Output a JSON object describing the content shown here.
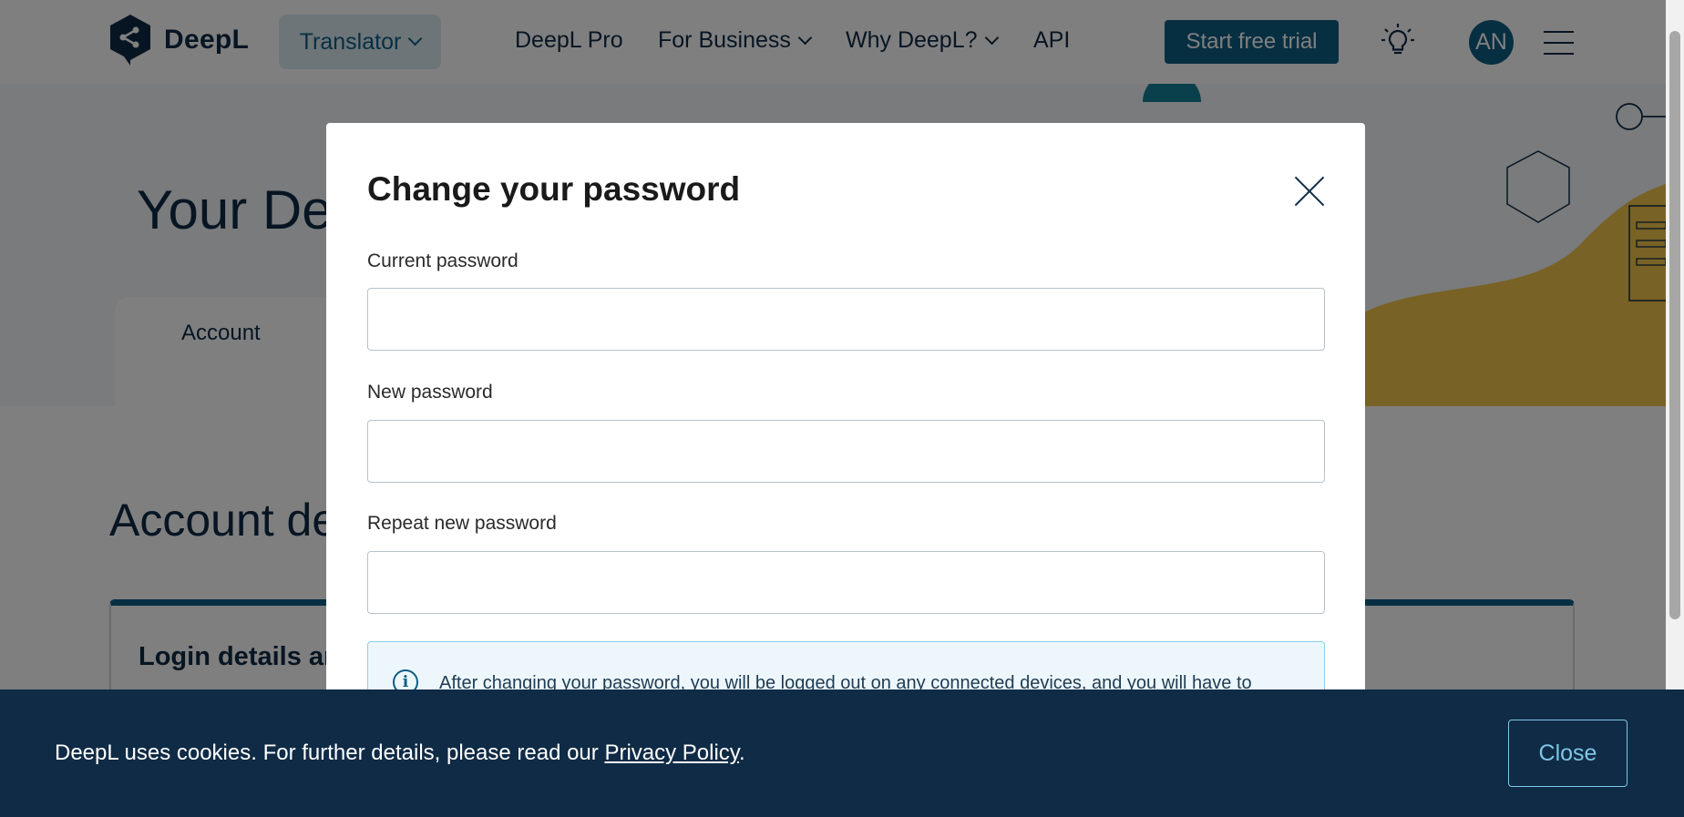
{
  "header": {
    "brand": "DeepL",
    "translator_label": "Translator",
    "nav": {
      "pro": "DeepL Pro",
      "business": "For Business",
      "why": "Why DeepL?",
      "api": "API"
    },
    "trial_button": "Start free trial",
    "avatar_initials": "AN"
  },
  "page": {
    "hero_title": "Your DeepL",
    "tab_account": "Account",
    "section_title": "Account details",
    "card_title": "Login details and"
  },
  "modal": {
    "title": "Change your password",
    "fields": [
      {
        "label": "Current password",
        "value": ""
      },
      {
        "label": "New password",
        "value": ""
      },
      {
        "label": "Repeat new password",
        "value": ""
      }
    ],
    "info_text": "After changing your password, you will be logged out on any connected devices, and you will have to"
  },
  "cookie": {
    "text_before": "DeepL uses cookies. For further details, please read our ",
    "link": "Privacy Policy",
    "text_after": ".",
    "close_label": "Close"
  },
  "colors": {
    "brand_dark": "#0f2b46",
    "brand_blue": "#0f5e84",
    "accent_yellow": "#f2c44a",
    "info_bg": "#edf7fb"
  }
}
